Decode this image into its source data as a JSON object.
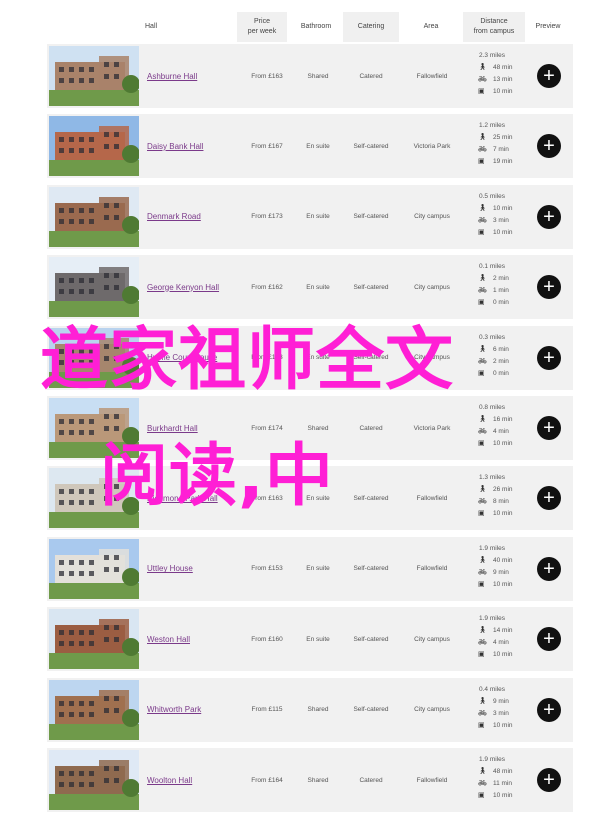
{
  "header": {
    "hall": "Hall",
    "price_line1": "Price",
    "price_line2": "per week",
    "bathroom": "Bathroom",
    "catering": "Catering",
    "area": "Area",
    "distance_line1": "Distance",
    "distance_line2": "from campus",
    "preview": "Preview"
  },
  "icons": {
    "walk": "walk-icon",
    "bike": "bike-icon",
    "bus": "bus-icon",
    "preview": "plus-icon"
  },
  "colors": {
    "link": "#7b3a8a",
    "row_bg": "#f1f1f1",
    "overlay_text": "#ff1fd5",
    "preview_btn": "#111111"
  },
  "rows": [
    {
      "name": "Ashburne Hall",
      "price": "From £163",
      "bathroom": "Shared",
      "catering": "Catered",
      "area": "Fallowfield",
      "miles": "2.3 miles",
      "walk": "48 min",
      "bike": "13 min",
      "bus": "10 min"
    },
    {
      "name": "Daisy Bank Hall",
      "price": "From £167",
      "bathroom": "En suite",
      "catering": "Self-catered",
      "area": "Victoria Park",
      "miles": "1.2 miles",
      "walk": "25 min",
      "bike": "7 min",
      "bus": "19 min"
    },
    {
      "name": "Denmark Road",
      "price": "From £173",
      "bathroom": "En suite",
      "catering": "Self-catered",
      "area": "City campus",
      "miles": "0.5 miles",
      "walk": "10 min",
      "bike": "3 min",
      "bus": "10 min"
    },
    {
      "name": "George Kenyon Hall",
      "price": "From £162",
      "bathroom": "En suite",
      "catering": "Self-catered",
      "area": "City campus",
      "miles": "0.1 miles",
      "walk": "2 min",
      "bike": "1 min",
      "bus": "0 min"
    },
    {
      "name": "Hulme Court House",
      "price": "From £163",
      "bathroom": "En suite",
      "catering": "Self-catered",
      "area": "City campus",
      "miles": "0.3 miles",
      "walk": "6 min",
      "bike": "2 min",
      "bus": "0 min"
    },
    {
      "name": "Burkhardt Hall",
      "price": "From £174",
      "bathroom": "Shared",
      "catering": "Catered",
      "area": "Victoria Park",
      "miles": "0.8 miles",
      "walk": "16 min",
      "bike": "4 min",
      "bus": "10 min"
    },
    {
      "name": "Richmond Park Hall",
      "price": "From £163",
      "bathroom": "En suite",
      "catering": "Self-catered",
      "area": "Fallowfield",
      "miles": "1.3 miles",
      "walk": "26 min",
      "bike": "8 min",
      "bus": "10 min"
    },
    {
      "name": "Uttley House",
      "price": "From £153",
      "bathroom": "En suite",
      "catering": "Self-catered",
      "area": "Fallowfield",
      "miles": "1.9 miles",
      "walk": "40 min",
      "bike": "9 min",
      "bus": "10 min"
    },
    {
      "name": "Weston Hall",
      "price": "From £160",
      "bathroom": "En suite",
      "catering": "Self-catered",
      "area": "City campus",
      "miles": "1.9 miles",
      "walk": "14 min",
      "bike": "4 min",
      "bus": "10 min"
    },
    {
      "name": "Whitworth Park",
      "price": "From £115",
      "bathroom": "Shared",
      "catering": "Self-catered",
      "area": "City campus",
      "miles": "0.4 miles",
      "walk": "9 min",
      "bike": "3 min",
      "bus": "10 min"
    },
    {
      "name": "Woolton Hall",
      "price": "From £164",
      "bathroom": "Shared",
      "catering": "Catered",
      "area": "Fallowfield",
      "miles": "1.9 miles",
      "walk": "48 min",
      "bike": "11 min",
      "bus": "10 min"
    }
  ],
  "overlay": {
    "line1": "道家祖师全文",
    "line2": "阅读,中"
  }
}
